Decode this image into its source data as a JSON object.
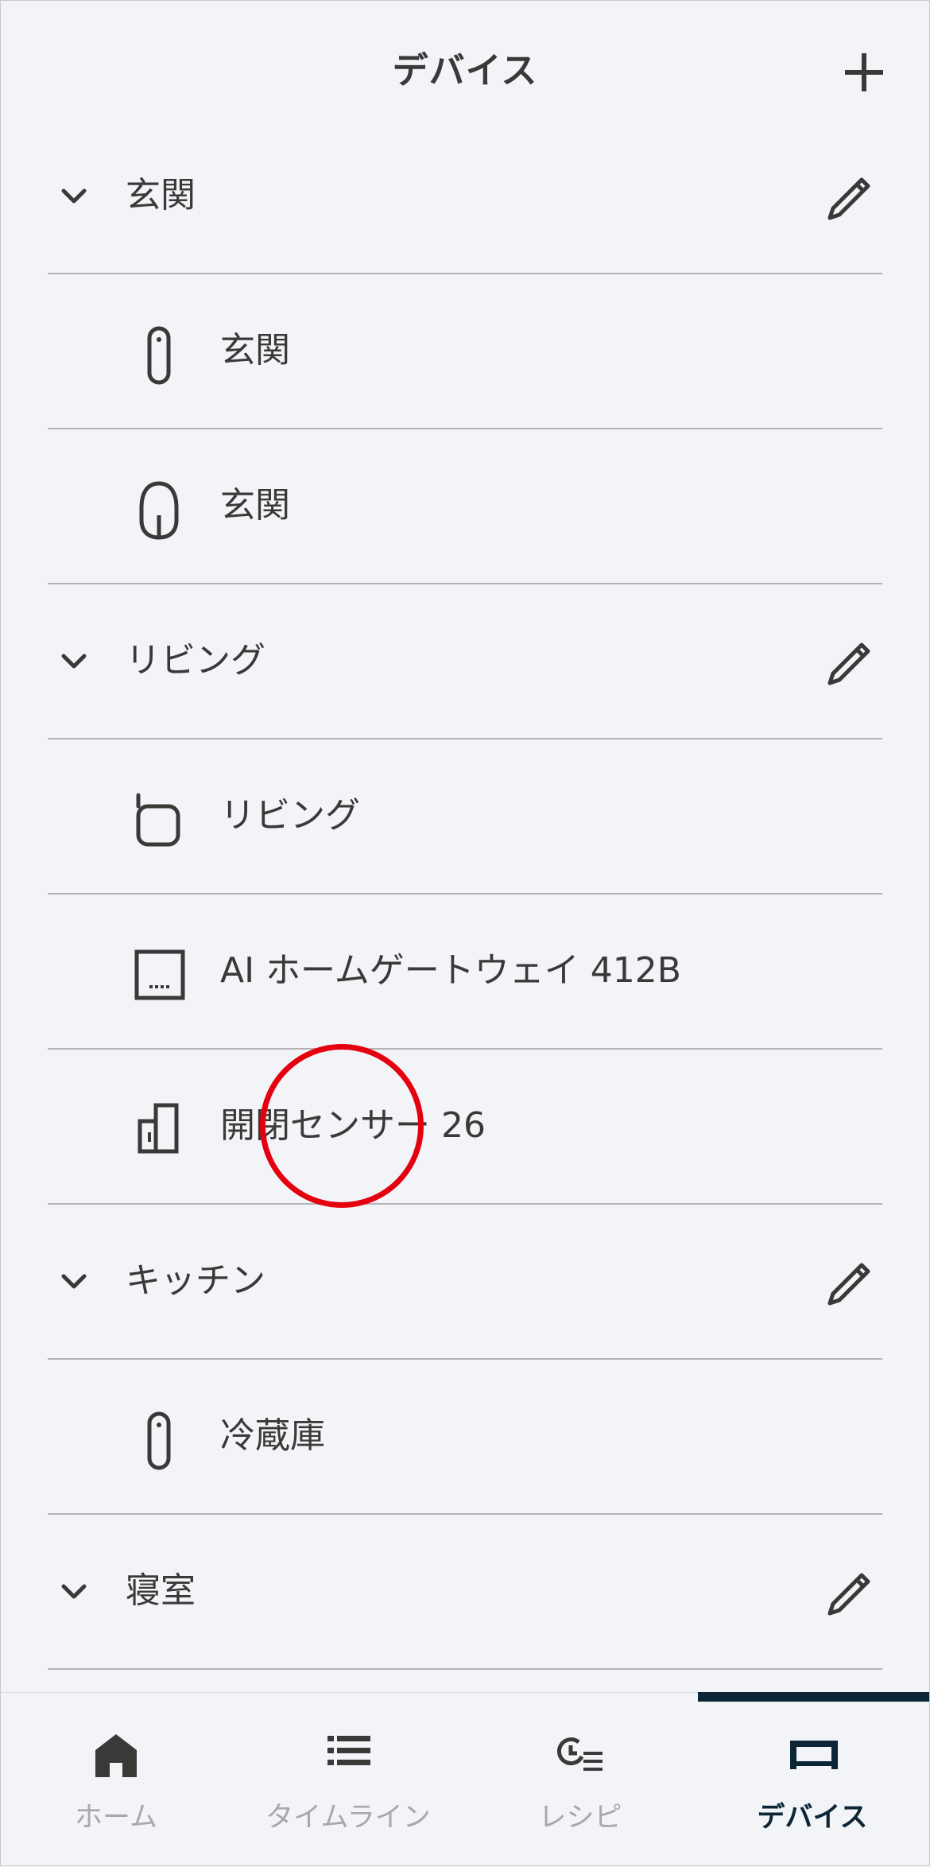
{
  "header": {
    "title": "デバイス"
  },
  "rooms": [
    {
      "name": "玄関",
      "devices": [
        {
          "name": "玄関",
          "icon": "remote-sensor-icon"
        },
        {
          "name": "玄関",
          "icon": "motion-sensor-icon"
        }
      ]
    },
    {
      "name": "リビング",
      "devices": [
        {
          "name": "リビング",
          "icon": "smart-remote-icon"
        },
        {
          "name": "AI ホームゲートウェイ 412B",
          "icon": "gateway-icon"
        },
        {
          "name": "開閉センサー 26",
          "icon": "door-sensor-icon"
        }
      ]
    },
    {
      "name": "キッチン",
      "devices": [
        {
          "name": "冷蔵庫",
          "icon": "remote-sensor-icon"
        }
      ]
    },
    {
      "name": "寝室",
      "devices": []
    }
  ],
  "tabs": [
    {
      "label": "ホーム",
      "icon": "home-icon"
    },
    {
      "label": "タイムライン",
      "icon": "list-icon"
    },
    {
      "label": "レシピ",
      "icon": "recipe-icon"
    },
    {
      "label": "デバイス",
      "icon": "device-icon"
    }
  ],
  "active_tab": "デバイス",
  "colors": {
    "background": "#f3f4f8",
    "text": "#3b3838",
    "divider": "#b3b3b3",
    "active": "#0d2636",
    "inactive": "#a7a8ae",
    "tap_marker": "#e4000f"
  }
}
